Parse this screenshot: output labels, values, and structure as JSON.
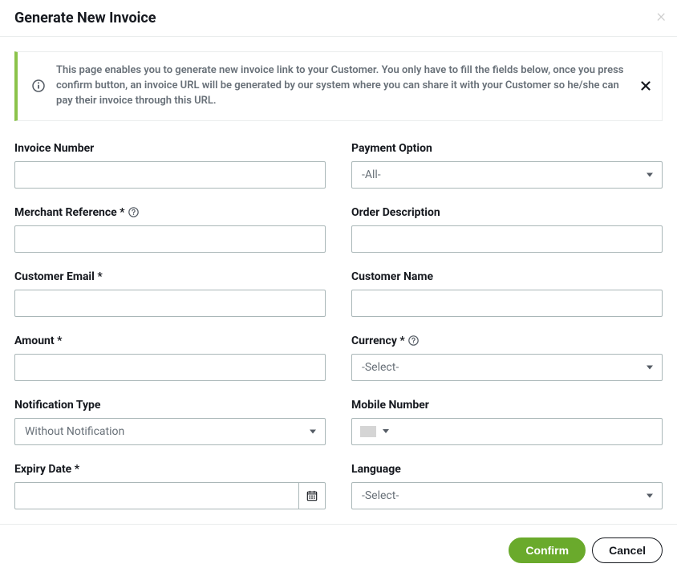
{
  "header": {
    "title": "Generate New Invoice"
  },
  "banner": {
    "text": "This page enables you to generate new invoice link to your Customer. You only have to fill the fields below, once you press confirm button, an invoice URL will be generated by our system where you can share it with your Customer so he/she can pay their invoice through this URL."
  },
  "fields": {
    "invoice_number": {
      "label": "Invoice Number",
      "value": ""
    },
    "payment_option": {
      "label": "Payment Option",
      "selected": "-All-"
    },
    "merchant_reference": {
      "label": "Merchant Reference *",
      "value": ""
    },
    "order_description": {
      "label": "Order Description",
      "value": ""
    },
    "customer_email": {
      "label": "Customer Email *",
      "value": ""
    },
    "customer_name": {
      "label": "Customer Name",
      "value": ""
    },
    "amount": {
      "label": "Amount *",
      "value": ""
    },
    "currency": {
      "label": "Currency *",
      "selected": "-Select-"
    },
    "notification_type": {
      "label": "Notification Type",
      "selected": "Without Notification"
    },
    "mobile_number": {
      "label": "Mobile Number",
      "value": ""
    },
    "expiry_date": {
      "label": "Expiry Date *",
      "value": ""
    },
    "language": {
      "label": "Language",
      "selected": "-Select-"
    }
  },
  "footer": {
    "confirm": "Confirm",
    "cancel": "Cancel"
  }
}
